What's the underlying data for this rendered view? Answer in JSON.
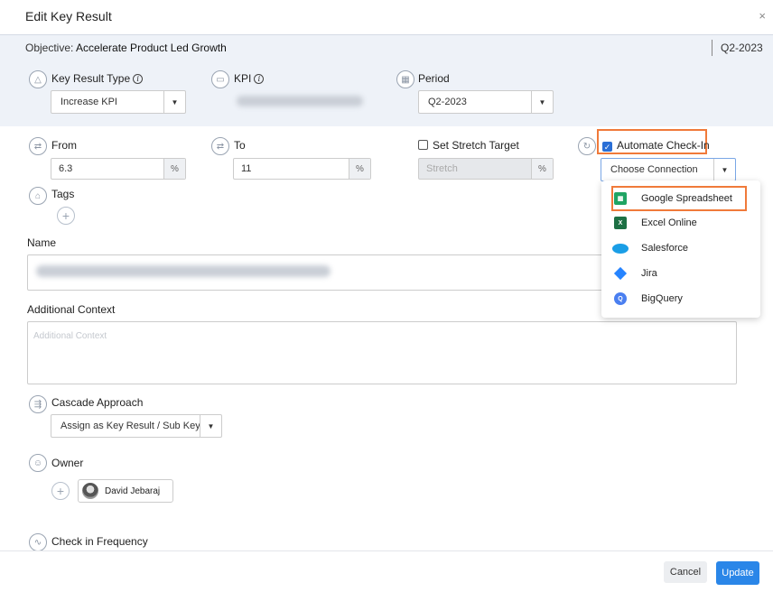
{
  "dialog": {
    "title": "Edit Key Result",
    "close": "×"
  },
  "objective": {
    "label_prefix": "Objective:",
    "label_value": "Accelerate Product Led Growth",
    "period": "Q2-2023"
  },
  "key_result_type": {
    "label": "Key Result Type",
    "value": "Increase KPI"
  },
  "kpi": {
    "label": "KPI"
  },
  "period": {
    "label": "Period",
    "value": "Q2-2023"
  },
  "from": {
    "label": "From",
    "value": "6.3",
    "unit": "%"
  },
  "to": {
    "label": "To",
    "value": "11",
    "unit": "%"
  },
  "stretch": {
    "label": "Set Stretch Target",
    "placeholder": "Stretch",
    "unit": "%",
    "checked": false
  },
  "automate": {
    "label": "Automate Check-In",
    "checked": true,
    "connection_placeholder": "Choose Connection"
  },
  "connections": [
    {
      "label": "Google Spreadsheet",
      "icon": "google-sheets-icon",
      "color": "#1fa463"
    },
    {
      "label": "Excel Online",
      "icon": "excel-icon",
      "color": "#1d7044"
    },
    {
      "label": "Salesforce",
      "icon": "salesforce-icon",
      "color": "#1a9ee6"
    },
    {
      "label": "Jira",
      "icon": "jira-icon",
      "color": "#2684ff"
    },
    {
      "label": "BigQuery",
      "icon": "bigquery-icon",
      "color": "#4a7ff0"
    }
  ],
  "tags": {
    "label": "Tags"
  },
  "name": {
    "label": "Name"
  },
  "context": {
    "label": "Additional Context",
    "placeholder": "Additional Context"
  },
  "cascade": {
    "label": "Cascade Approach",
    "value": "Assign as Key Result / Sub Key ..."
  },
  "owner": {
    "label": "Owner",
    "person": "David Jebaraj"
  },
  "frequency": {
    "label": "Check in Frequency"
  },
  "footer": {
    "cancel": "Cancel",
    "update": "Update"
  },
  "colors": {
    "accent": "#2a86e8",
    "highlight": "#f07a3a",
    "band": "#eef2f8"
  }
}
